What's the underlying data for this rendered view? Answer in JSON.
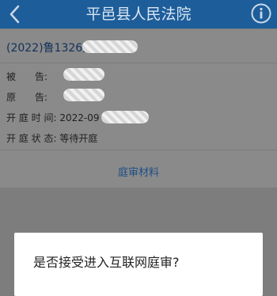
{
  "header": {
    "title": "平邑县人民法院",
    "back_icon": "chevron-left-icon",
    "info_icon": "info-circle-icon"
  },
  "case": {
    "number": "(2022)鲁1326民",
    "defendant_label": "被　　告:",
    "plaintiff_label": "原　　告:",
    "court_time_label": "开 庭 时 间:",
    "court_time_value": "2022-09",
    "court_status_label": "开 庭 状 态:",
    "court_status_value": "等待开庭",
    "materials_link": "庭审材料"
  },
  "dialog": {
    "question": "是否接受进入互联网庭审?"
  },
  "colors": {
    "header_bg": "#1d5d9a",
    "overlay": "#7d7d7d",
    "link": "#1d4f85"
  }
}
